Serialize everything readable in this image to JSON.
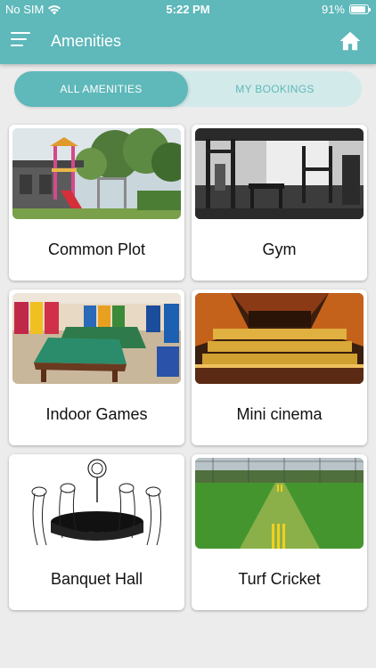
{
  "status_bar": {
    "carrier": "No SIM",
    "time": "5:22 PM",
    "battery_percent_label": "91%",
    "battery_level": 0.91
  },
  "app_bar": {
    "title": "Amenities",
    "menu_icon": "hamburger-menu-icon",
    "home_icon": "home-icon"
  },
  "tabs": [
    {
      "label": "ALL AMENITIES",
      "active": true
    },
    {
      "label": "MY BOOKINGS",
      "active": false
    }
  ],
  "amenities": [
    {
      "name": "Common Plot"
    },
    {
      "name": "Gym"
    },
    {
      "name": "Indoor Games"
    },
    {
      "name": "Mini cinema"
    },
    {
      "name": "Banquet Hall"
    },
    {
      "name": "Turf Cricket"
    }
  ],
  "colors": {
    "primary": "#5fb8ba",
    "tab_track": "#d3eaea",
    "background": "#ececec"
  }
}
